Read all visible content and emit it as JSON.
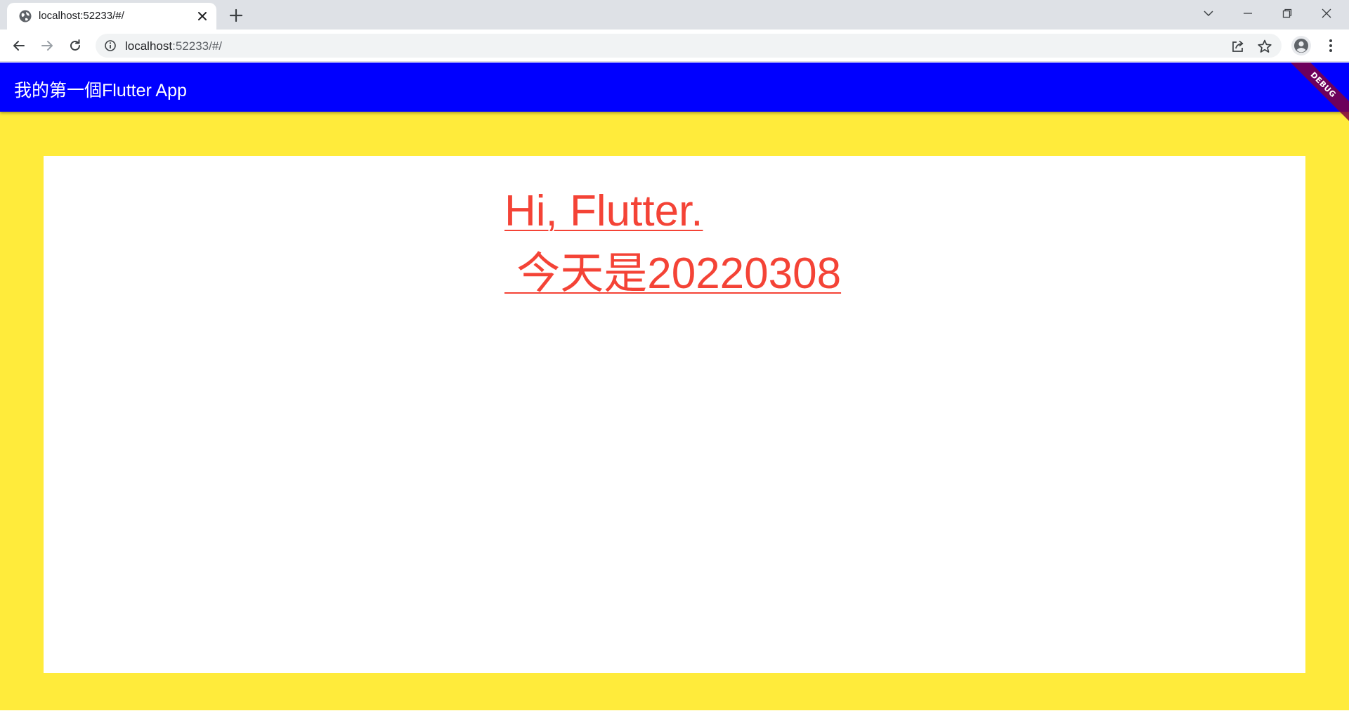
{
  "browser": {
    "tab": {
      "title": "localhost:52233/#/"
    },
    "address": {
      "host": "localhost",
      "rest": ":52233/#/"
    }
  },
  "app": {
    "appbar_title": "我的第一個Flutter App",
    "debug_banner": "DEBUG",
    "body_text_line1": "Hi, Flutter.",
    "body_text_line2": " 今天是20220308"
  },
  "colors": {
    "appbar": "#0000ff",
    "background": "#ffeb3b",
    "card": "#ffffff",
    "text": "#f44336",
    "debug_banner": "#800040"
  },
  "icons": {
    "tab_favicon": "globe-icon",
    "tab_close": "close-icon",
    "new_tab": "plus-icon",
    "back": "arrow-left-icon",
    "forward": "arrow-right-icon",
    "reload": "reload-icon",
    "site_info": "info-icon",
    "share": "share-icon",
    "bookmark": "star-icon",
    "profile": "person-icon",
    "menu": "more-vert-icon",
    "tab_search": "chevron-down-icon",
    "minimize": "minimize-icon",
    "restore": "restore-icon",
    "close_window": "close-window-icon"
  }
}
